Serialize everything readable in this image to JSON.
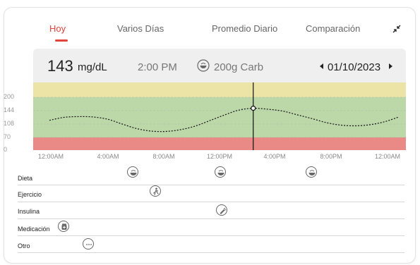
{
  "tabs": [
    {
      "label": "Hoy",
      "active": true
    },
    {
      "label": "Varios Días",
      "active": false
    },
    {
      "label": "Promedio Diario",
      "active": false
    },
    {
      "label": "Comparación",
      "active": false
    }
  ],
  "header": {
    "glucose_value": "143",
    "glucose_unit": "mg/dL",
    "time": "2:00 PM",
    "carb": "200g Carb",
    "date": "01/10/2023"
  },
  "chart_data": {
    "type": "line",
    "y_ticks": [
      "200",
      "144",
      "108",
      "70",
      "0"
    ],
    "x_ticks": [
      "12:00AM",
      "4:00AM",
      "8:00AM",
      "12:00PM",
      "4:00PM",
      "8:00PM",
      "12:00AM"
    ],
    "bands": [
      {
        "from": 200,
        "to": 240,
        "color": "#ece3a6"
      },
      {
        "from": 70,
        "to": 200,
        "color": "#bdd8a8"
      },
      {
        "from": 0,
        "to": 70,
        "color": "#ea8a86"
      }
    ],
    "series": [
      {
        "x": [
          0,
          1,
          2,
          3,
          4,
          5,
          6,
          7,
          8,
          9,
          10,
          11,
          12,
          13,
          14,
          15,
          16,
          17,
          18,
          19,
          20,
          21,
          22,
          23,
          24
        ],
        "y": [
          118,
          126,
          128,
          127,
          121,
          108,
          95,
          88,
          87,
          92,
          102,
          117,
          132,
          146,
          154,
          150,
          143,
          133,
          123,
          112,
          105,
          103,
          106,
          114,
          127
        ]
      }
    ],
    "selected": {
      "x": 14,
      "y": 154
    },
    "xlim": [
      0,
      24
    ],
    "grid": true
  },
  "events": {
    "rows": [
      "Dieta",
      "Ejercicio",
      "Insulina",
      "Medicación",
      "Otro"
    ],
    "items": [
      {
        "row": 0,
        "hour": 8,
        "icon": "food-icon"
      },
      {
        "row": 0,
        "hour": 16,
        "icon": "food-icon"
      },
      {
        "row": 0,
        "hour": 24,
        "icon": "food-icon"
      },
      {
        "row": 1,
        "hour": 10,
        "icon": "exercise-icon"
      },
      {
        "row": 2,
        "hour": 16,
        "icon": "insulin-icon"
      },
      {
        "row": 3,
        "hour": 0,
        "icon": "medication-icon"
      },
      {
        "row": 4,
        "hour": 2,
        "icon": "more-icon"
      }
    ]
  },
  "colors": {
    "accent": "#e0443c",
    "header_bg": "#efefef"
  }
}
